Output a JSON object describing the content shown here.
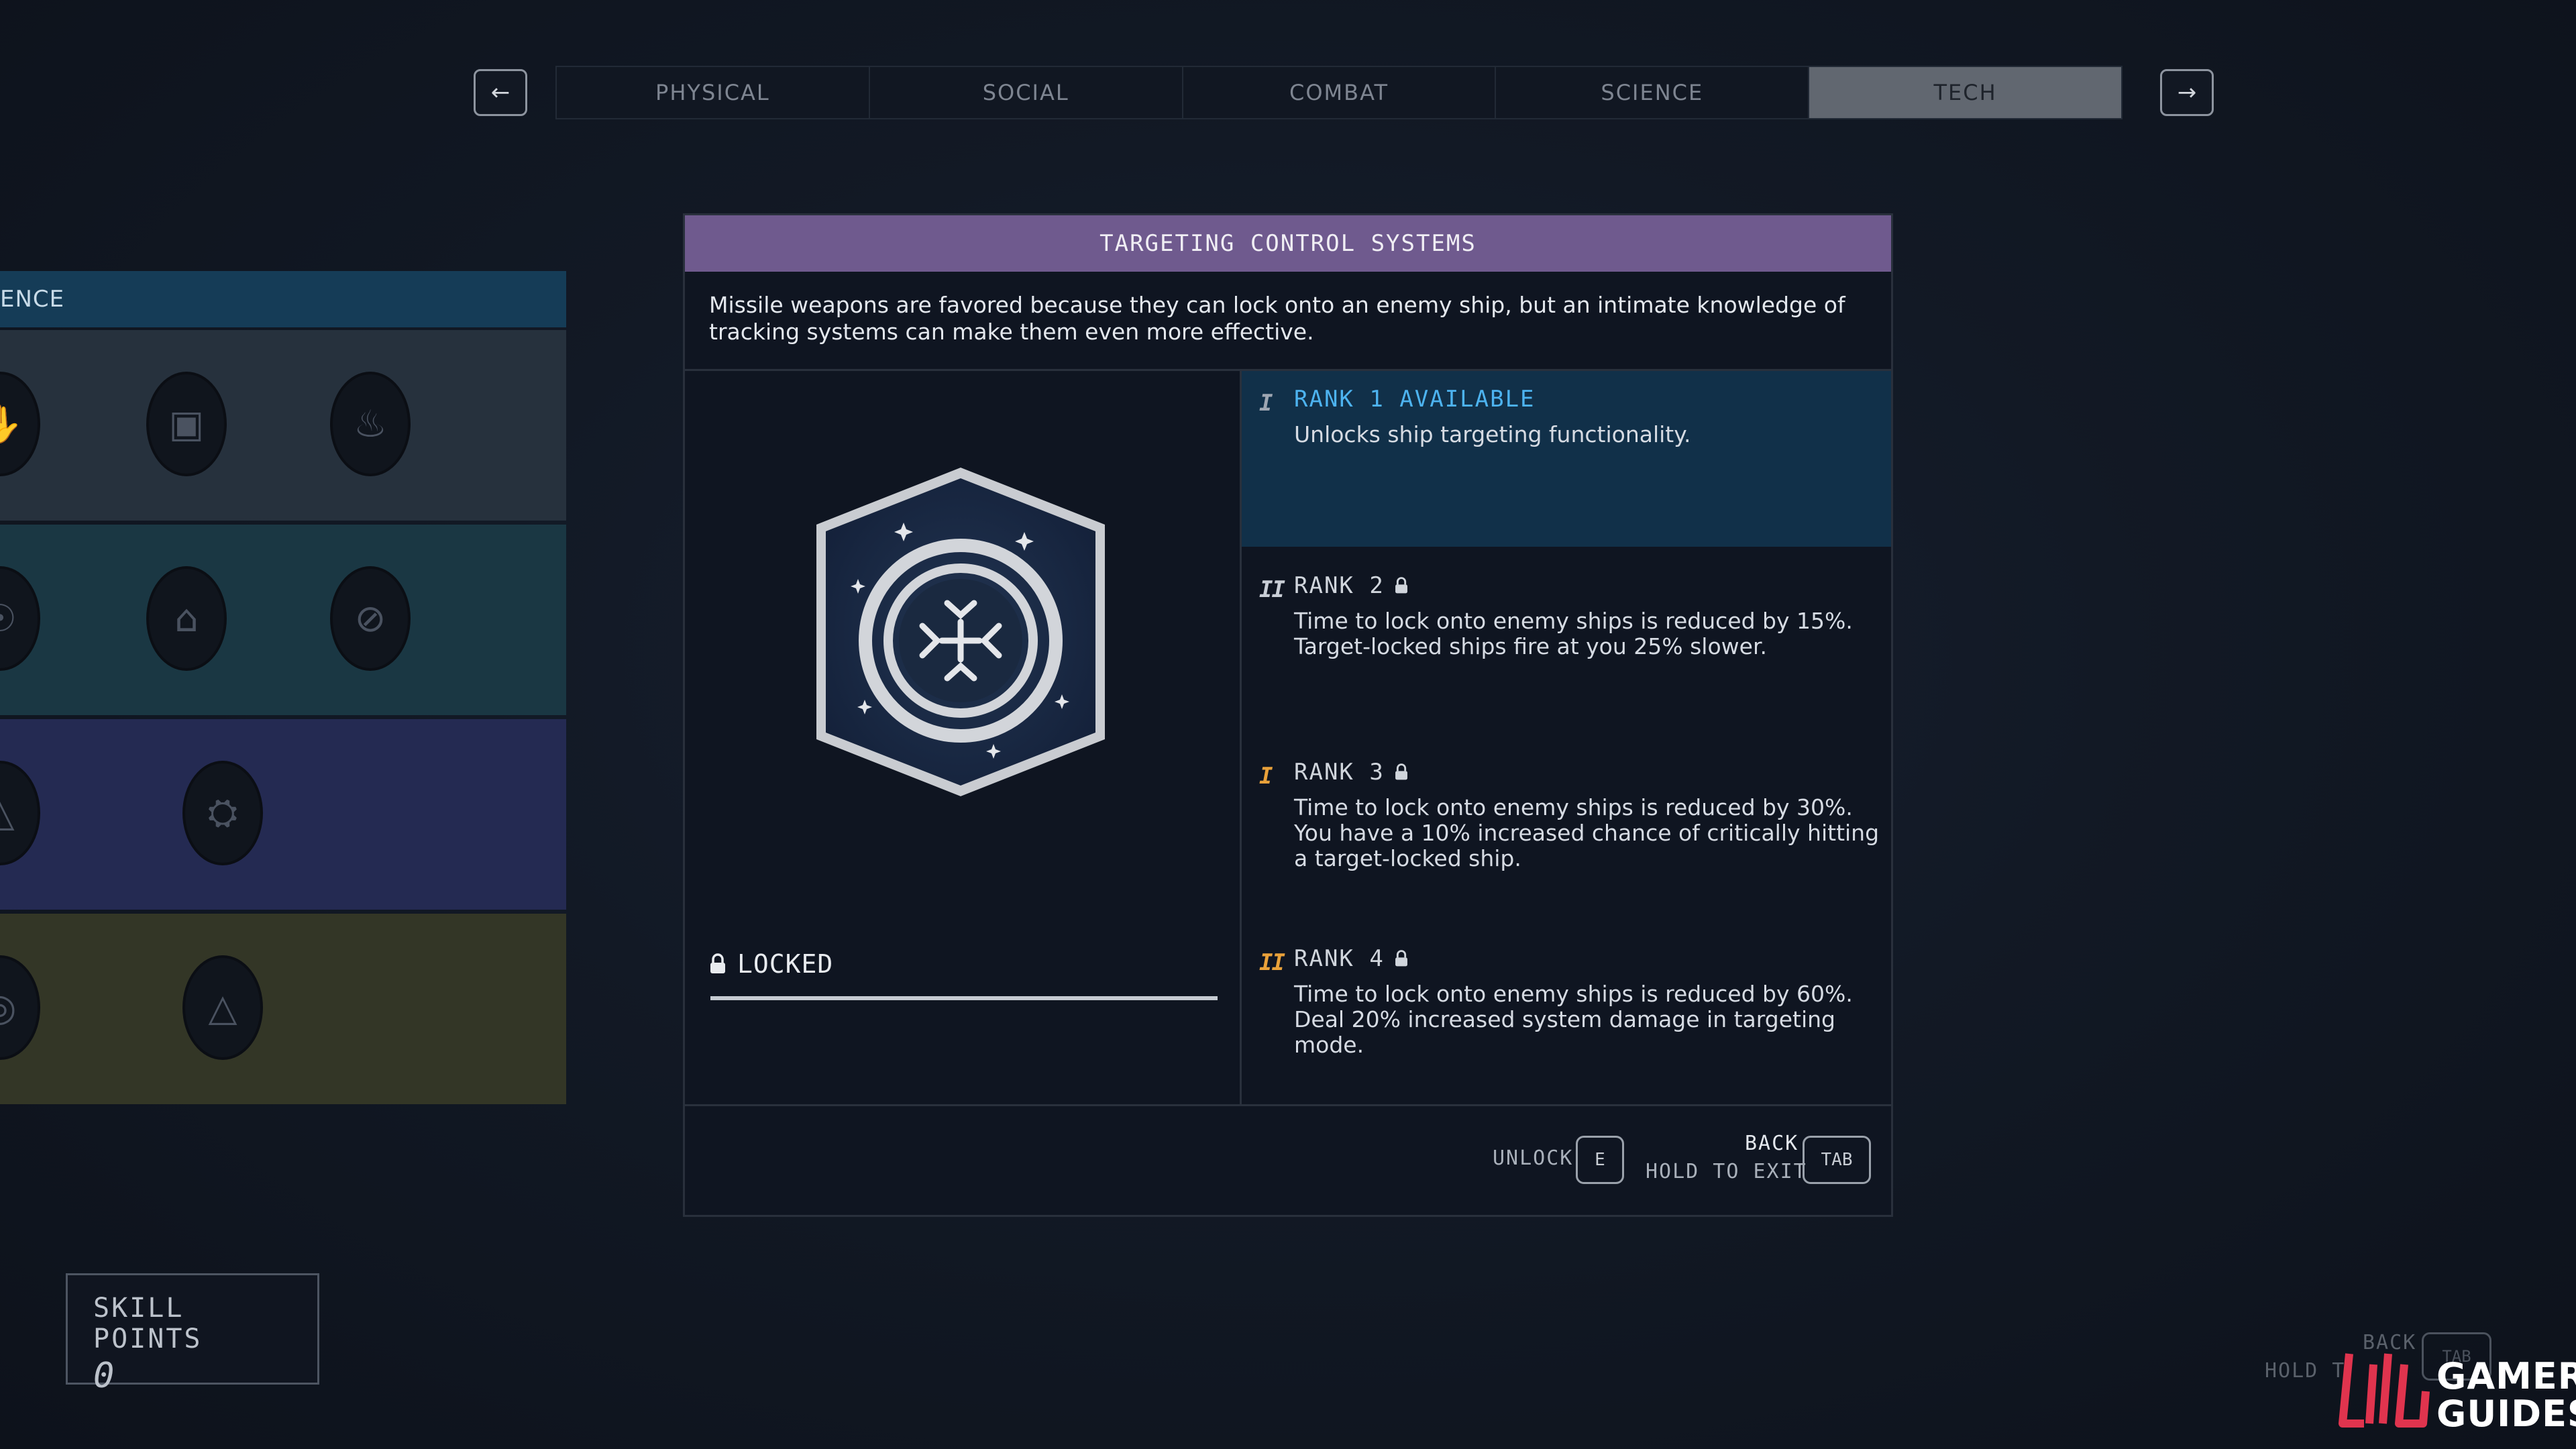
{
  "nav": {
    "prev_icon": "arrow-left-icon",
    "next_icon": "arrow-right-icon",
    "prev_glyph": "←",
    "next_glyph": "→",
    "tabs": [
      {
        "label": "PHYSICAL",
        "active": false
      },
      {
        "label": "SOCIAL",
        "active": false
      },
      {
        "label": "COMBAT",
        "active": false
      },
      {
        "label": "SCIENCE",
        "active": false
      },
      {
        "label": "TECH",
        "active": true
      }
    ]
  },
  "tree": {
    "header_label": "ENCE"
  },
  "skill_points": {
    "label": "SKILL POINTS",
    "value": "0"
  },
  "skill": {
    "title": "TARGETING CONTROL SYSTEMS",
    "description": "Missile weapons are favored because they can lock onto an enemy ship, but an intimate knowledge of tracking systems can make them even more effective.",
    "status_label": "LOCKED",
    "badge_icon": "targeting-reticle-badge-icon",
    "ranks": [
      {
        "mark": "I",
        "title": "RANK 1 AVAILABLE",
        "locked": false,
        "available": true,
        "color": "#4db3f0",
        "description": "Unlocks ship targeting functionality."
      },
      {
        "mark": "II",
        "title": "RANK 2",
        "locked": true,
        "available": false,
        "color": "#d0d5dc",
        "description": "Time to lock onto enemy ships is reduced by 15%. Target-locked ships fire at you 25% slower."
      },
      {
        "mark": "I",
        "title": "RANK 3",
        "locked": true,
        "available": false,
        "color": "#e9a13a",
        "description": "Time to lock onto enemy ships is reduced by 30%. You have a 10% increased chance of critically hitting a target-locked ship."
      },
      {
        "mark": "II",
        "title": "RANK 4",
        "locked": true,
        "available": false,
        "color": "#e9a13a",
        "description": "Time to lock onto enemy ships is reduced by 60%. Deal 20% increased system damage in targeting mode."
      }
    ]
  },
  "footer": {
    "unlock_label": "UNLOCK",
    "unlock_key": "E",
    "back_label": "BACK",
    "exit_label": "HOLD TO EXIT",
    "tab_key": "TAB"
  },
  "ghost": {
    "back_label": "BACK",
    "hold_label": "HOLD T",
    "tab_key": "TAB"
  },
  "logo": {
    "line1": "GAMER",
    "line2": "GUIDES"
  },
  "colors": {
    "title_bar": "#6f5a8e",
    "available_bg": "#113049",
    "tab_active": "#616770"
  }
}
